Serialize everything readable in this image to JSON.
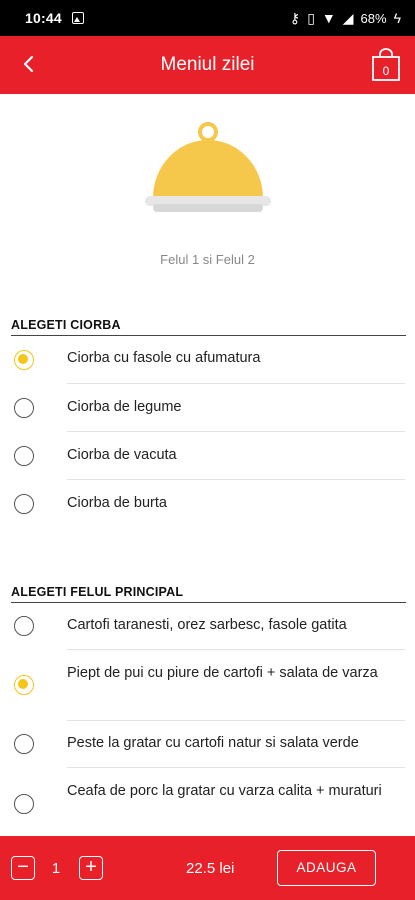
{
  "status_bar": {
    "time": "10:44",
    "battery": "68%",
    "icons": [
      "image-icon",
      "key-icon",
      "vibrate-icon",
      "wifi-icon",
      "signal-icon",
      "battery-charging-icon"
    ]
  },
  "app_bar": {
    "title": "Meniul zilei",
    "back_icon": "chevron-left-icon",
    "cart_icon": "shopping-bag-icon",
    "cart_count": "0"
  },
  "hero": {
    "icon": "food-cloche-icon",
    "subtitle": "Felul 1 si Felul 2"
  },
  "sections": [
    {
      "title": "ALEGETI CIORBA",
      "options": [
        {
          "label": "Ciorba cu fasole cu afumatura",
          "selected": true
        },
        {
          "label": "Ciorba de legume",
          "selected": false
        },
        {
          "label": "Ciorba de vacuta",
          "selected": false
        },
        {
          "label": "Ciorba de burta",
          "selected": false
        }
      ]
    },
    {
      "title": "ALEGETI FELUL PRINCIPAL",
      "options": [
        {
          "label": "Cartofi taranesti, orez sarbesc, fasole gatita",
          "selected": false
        },
        {
          "label": "Piept de pui cu piure de cartofi + salata de varza",
          "selected": true
        },
        {
          "label": "Peste la gratar cu cartofi natur si salata verde",
          "selected": false
        },
        {
          "label": "Ceafa de porc la gratar cu varza calita + muraturi",
          "selected": false
        }
      ]
    }
  ],
  "bottom_bar": {
    "quantity": "1",
    "minus": "−",
    "plus": "+",
    "price": "22.5 lei",
    "add_label": "ADAUGA"
  },
  "colors": {
    "brand_red": "#e8202a",
    "radio_selected": "#f5c518",
    "cloche_yellow": "#f5c84c"
  }
}
